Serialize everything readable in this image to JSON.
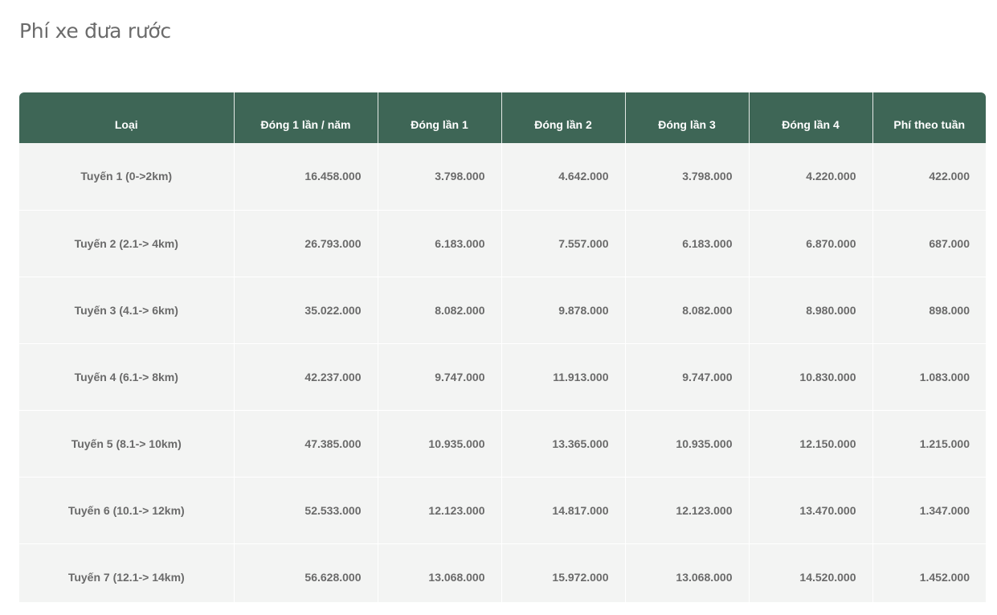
{
  "title": "Phí xe đưa rước",
  "table": {
    "headers": [
      "Loại",
      "Đóng 1 lần / năm",
      "Đóng lần 1",
      "Đóng lần 2",
      "Đóng lần 3",
      "Đóng lần 4",
      "Phí theo tuần"
    ],
    "rows": [
      [
        "Tuyến 1 (0->2km)",
        "16.458.000",
        "3.798.000",
        "4.642.000",
        "3.798.000",
        "4.220.000",
        "422.000"
      ],
      [
        "Tuyến 2 (2.1-> 4km)",
        "26.793.000",
        "6.183.000",
        "7.557.000",
        "6.183.000",
        "6.870.000",
        "687.000"
      ],
      [
        "Tuyến 3 (4.1-> 6km)",
        "35.022.000",
        "8.082.000",
        "9.878.000",
        "8.082.000",
        "8.980.000",
        "898.000"
      ],
      [
        "Tuyến 4 (6.1-> 8km)",
        "42.237.000",
        "9.747.000",
        "11.913.000",
        "9.747.000",
        "10.830.000",
        "1.083.000"
      ],
      [
        "Tuyến 5 (8.1-> 10km)",
        "47.385.000",
        "10.935.000",
        "13.365.000",
        "10.935.000",
        "12.150.000",
        "1.215.000"
      ],
      [
        "Tuyến 6 (10.1-> 12km)",
        "52.533.000",
        "12.123.000",
        "14.817.000",
        "12.123.000",
        "13.470.000",
        "1.347.000"
      ],
      [
        "Tuyến 7 (12.1-> 14km)",
        "56.628.000",
        "13.068.000",
        "15.972.000",
        "13.068.000",
        "14.520.000",
        "1.452.000"
      ]
    ]
  },
  "colors": {
    "header_bg": "#3e6656",
    "header_text": "#ffffff",
    "row_bg": "#f3f4f3",
    "body_text": "#6a6a6a",
    "title_text": "#6b6b6b"
  }
}
